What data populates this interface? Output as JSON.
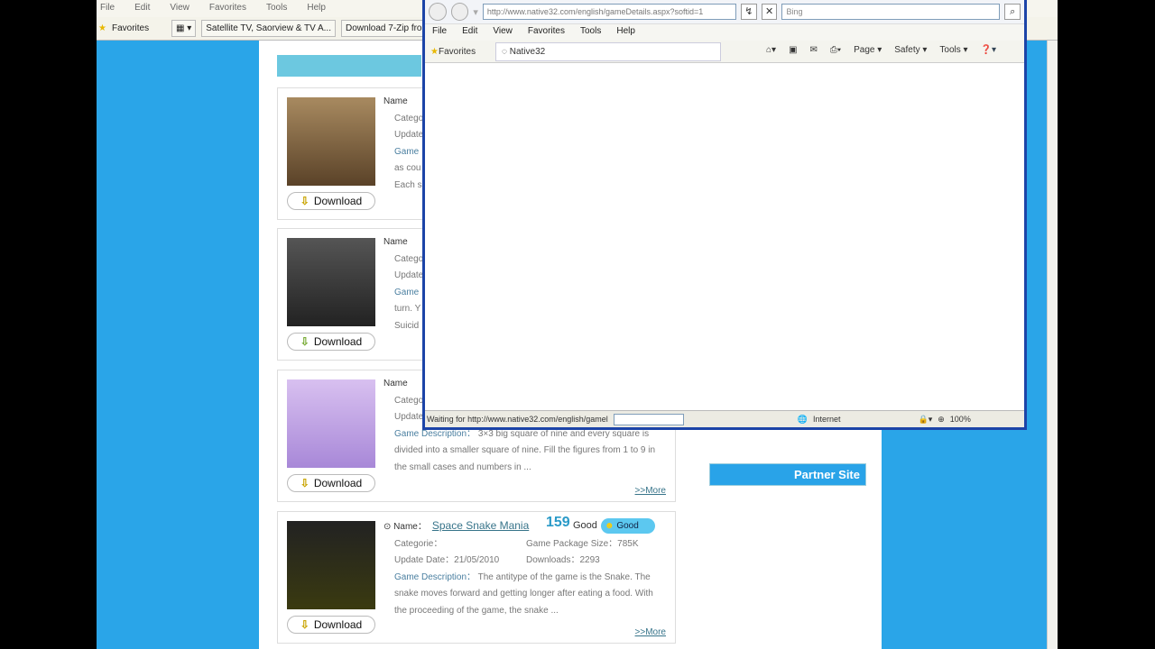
{
  "background_browser": {
    "menu": [
      "File",
      "Edit",
      "View",
      "Favorites",
      "Tools",
      "Help"
    ],
    "favorites_label": "Favorites",
    "tabs": [
      "Satellite TV, Saorview & TV A...",
      "Download 7-Zip from"
    ]
  },
  "games": [
    {
      "name_label": "Name",
      "category_label": "Catego",
      "update_label": "Update",
      "desc_label": "Game",
      "desc": [
        "as cou",
        "Each s"
      ],
      "download": "Download"
    },
    {
      "name_label": "Name",
      "category_label": "Catego",
      "update_label": "Update",
      "desc_label": "Game",
      "desc": [
        "turn. Y",
        "Suicid"
      ],
      "download": "Download"
    },
    {
      "name_label": "Name",
      "category_label": "Catego",
      "update_label": "Update",
      "desc_label": "Game Description：",
      "desc": [
        "3×3 big square of nine and every square is",
        "divided into a smaller square of nine. Fill the figures from 1 to 9 in",
        "the small cases and numbers in ..."
      ],
      "more": ">>More",
      "download": "Download"
    },
    {
      "name_label": "Name：",
      "name": "Space Snake Mania",
      "votes": "159",
      "rating_text": "Good",
      "rating_badge": "Good",
      "category_label": "Categorie：",
      "size_label": "Game Package Size：785K",
      "update_label": "Update Date：21/05/2010",
      "downloads_label": "Downloads：2293",
      "desc_label": "Game Description：",
      "desc": [
        "The antitype of the game is the Snake. The",
        "snake moves forward and getting longer after eating a food. With",
        "the proceeding of the game, the snake ..."
      ],
      "more": ">>More",
      "download": "Download"
    }
  ],
  "partner_site": "Partner Site",
  "popup": {
    "url": "http://www.native32.com/english/gameDetails.aspx?softid=1",
    "search_placeholder": "Bing",
    "menu": [
      "File",
      "Edit",
      "View",
      "Favorites",
      "Tools",
      "Help"
    ],
    "favorites_label": "Favorites",
    "tab_title": "Native32",
    "tools": [
      "Page ▾",
      "Safety ▾",
      "Tools ▾"
    ],
    "status": "Waiting for http://www.native32.com/english/gamel",
    "zone": "Internet",
    "zoom": "100%"
  }
}
